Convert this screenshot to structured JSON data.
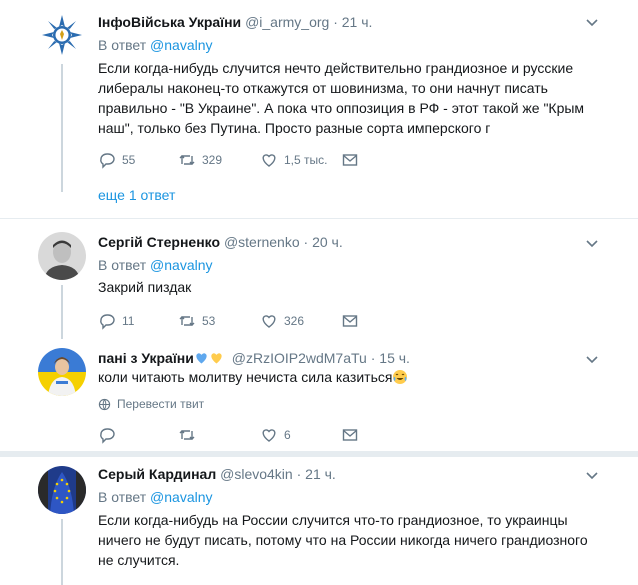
{
  "colors": {
    "accent": "#1b95e0",
    "muted": "#657786",
    "text": "#14171a",
    "divider": "#e6ecf0",
    "heart_blue": "#5fa8ee",
    "heart_yellow": "#ffcc4d"
  },
  "tweets": [
    {
      "name": "ІнфоВійська України",
      "handle": "@i_army_org",
      "dot": "·",
      "time": "21 ч.",
      "reply_prefix": "В ответ ",
      "reply_mention": "@navalny",
      "text": "Если когда-нибудь случится нечто действительно грандиозное и русские либералы наконец-то откажутся от шовинизма, то они начнут писать правильно - \"В Украине\". А пока что оппозиция в РФ - этот такой же \"Крым наш\", только без Путина. Просто разные сорта имперского г",
      "replies": "55",
      "retweets": "329",
      "likes": "1,5 тыс.",
      "more_replies": "еще 1 ответ",
      "avatar_icon": "shield-emblem-icon"
    },
    {
      "name": "Сергій Стерненко",
      "handle": "@sternenko",
      "dot": "·",
      "time": "20 ч.",
      "reply_prefix": "В ответ ",
      "reply_mention": "@navalny",
      "text": "Закрий пиздак",
      "replies": "11",
      "retweets": "53",
      "likes": "326",
      "avatar_icon": "person-photo-icon"
    },
    {
      "name": "пані з України",
      "handle": "@zRzIOIP2wdM7aTu",
      "dot": "·",
      "time": "15 ч.",
      "text": "коли читають молитву нечиста сила казиться",
      "translate": "Перевести твит",
      "replies": "",
      "retweets": "",
      "likes": "6",
      "avatar_icon": "person-flag-photo-icon"
    },
    {
      "name": "Серый Кардинал",
      "handle": "@slevo4kin",
      "dot": "·",
      "time": "21 ч.",
      "reply_prefix": "В ответ ",
      "reply_mention": "@navalny",
      "text": "Если когда-нибудь на России случится что-то грандиозное, то украинцы ничего не будут писать, потому что на России никогда ничего грандиозного не случится.",
      "avatar_icon": "eu-flag-figure-icon"
    }
  ]
}
